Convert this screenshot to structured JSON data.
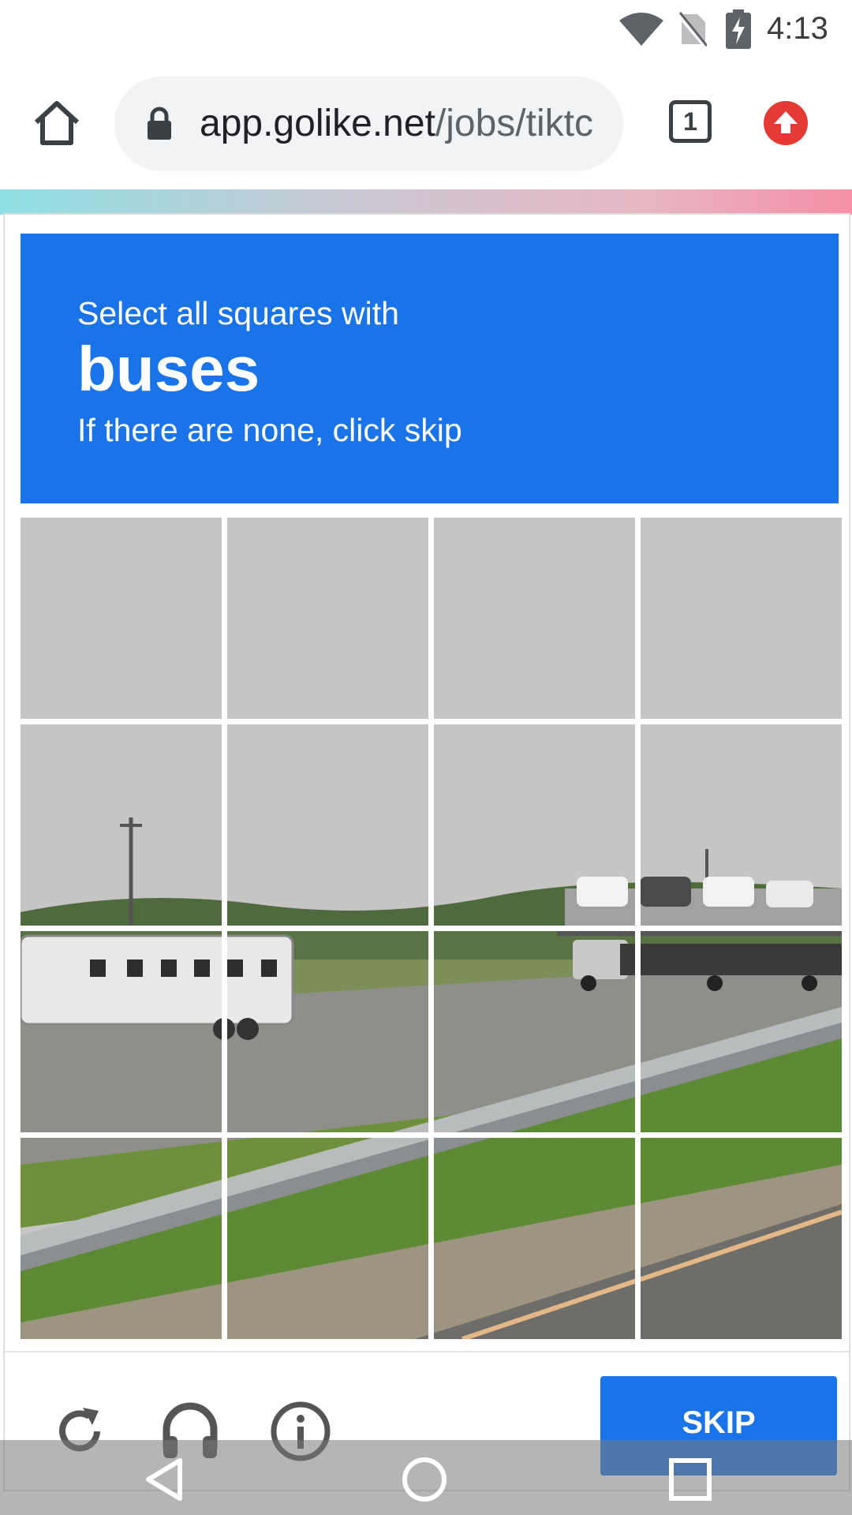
{
  "status_bar": {
    "time": "4:13",
    "icons": [
      "wifi-icon",
      "no-sim-icon",
      "battery-charging-icon"
    ]
  },
  "browser": {
    "url_domain": "app.golike.net",
    "url_path": "/jobs/tiktc",
    "tab_count": "1",
    "icons": [
      "home-icon",
      "lock-icon",
      "update-arrow-icon"
    ]
  },
  "captcha": {
    "instruction": "Select all squares with",
    "keyword": "buses",
    "hint": "If there are none, click skip",
    "grid_rows": 4,
    "grid_cols": 4,
    "controls": [
      "refresh-icon",
      "audio-challenge-icon",
      "info-icon"
    ],
    "skip_label": "SKIP"
  },
  "nav_bar": {
    "icons": [
      "back-icon",
      "home-circle-icon",
      "recents-icon"
    ]
  },
  "colors": {
    "primary": "#1a73e8",
    "update_badge": "#e53935"
  }
}
